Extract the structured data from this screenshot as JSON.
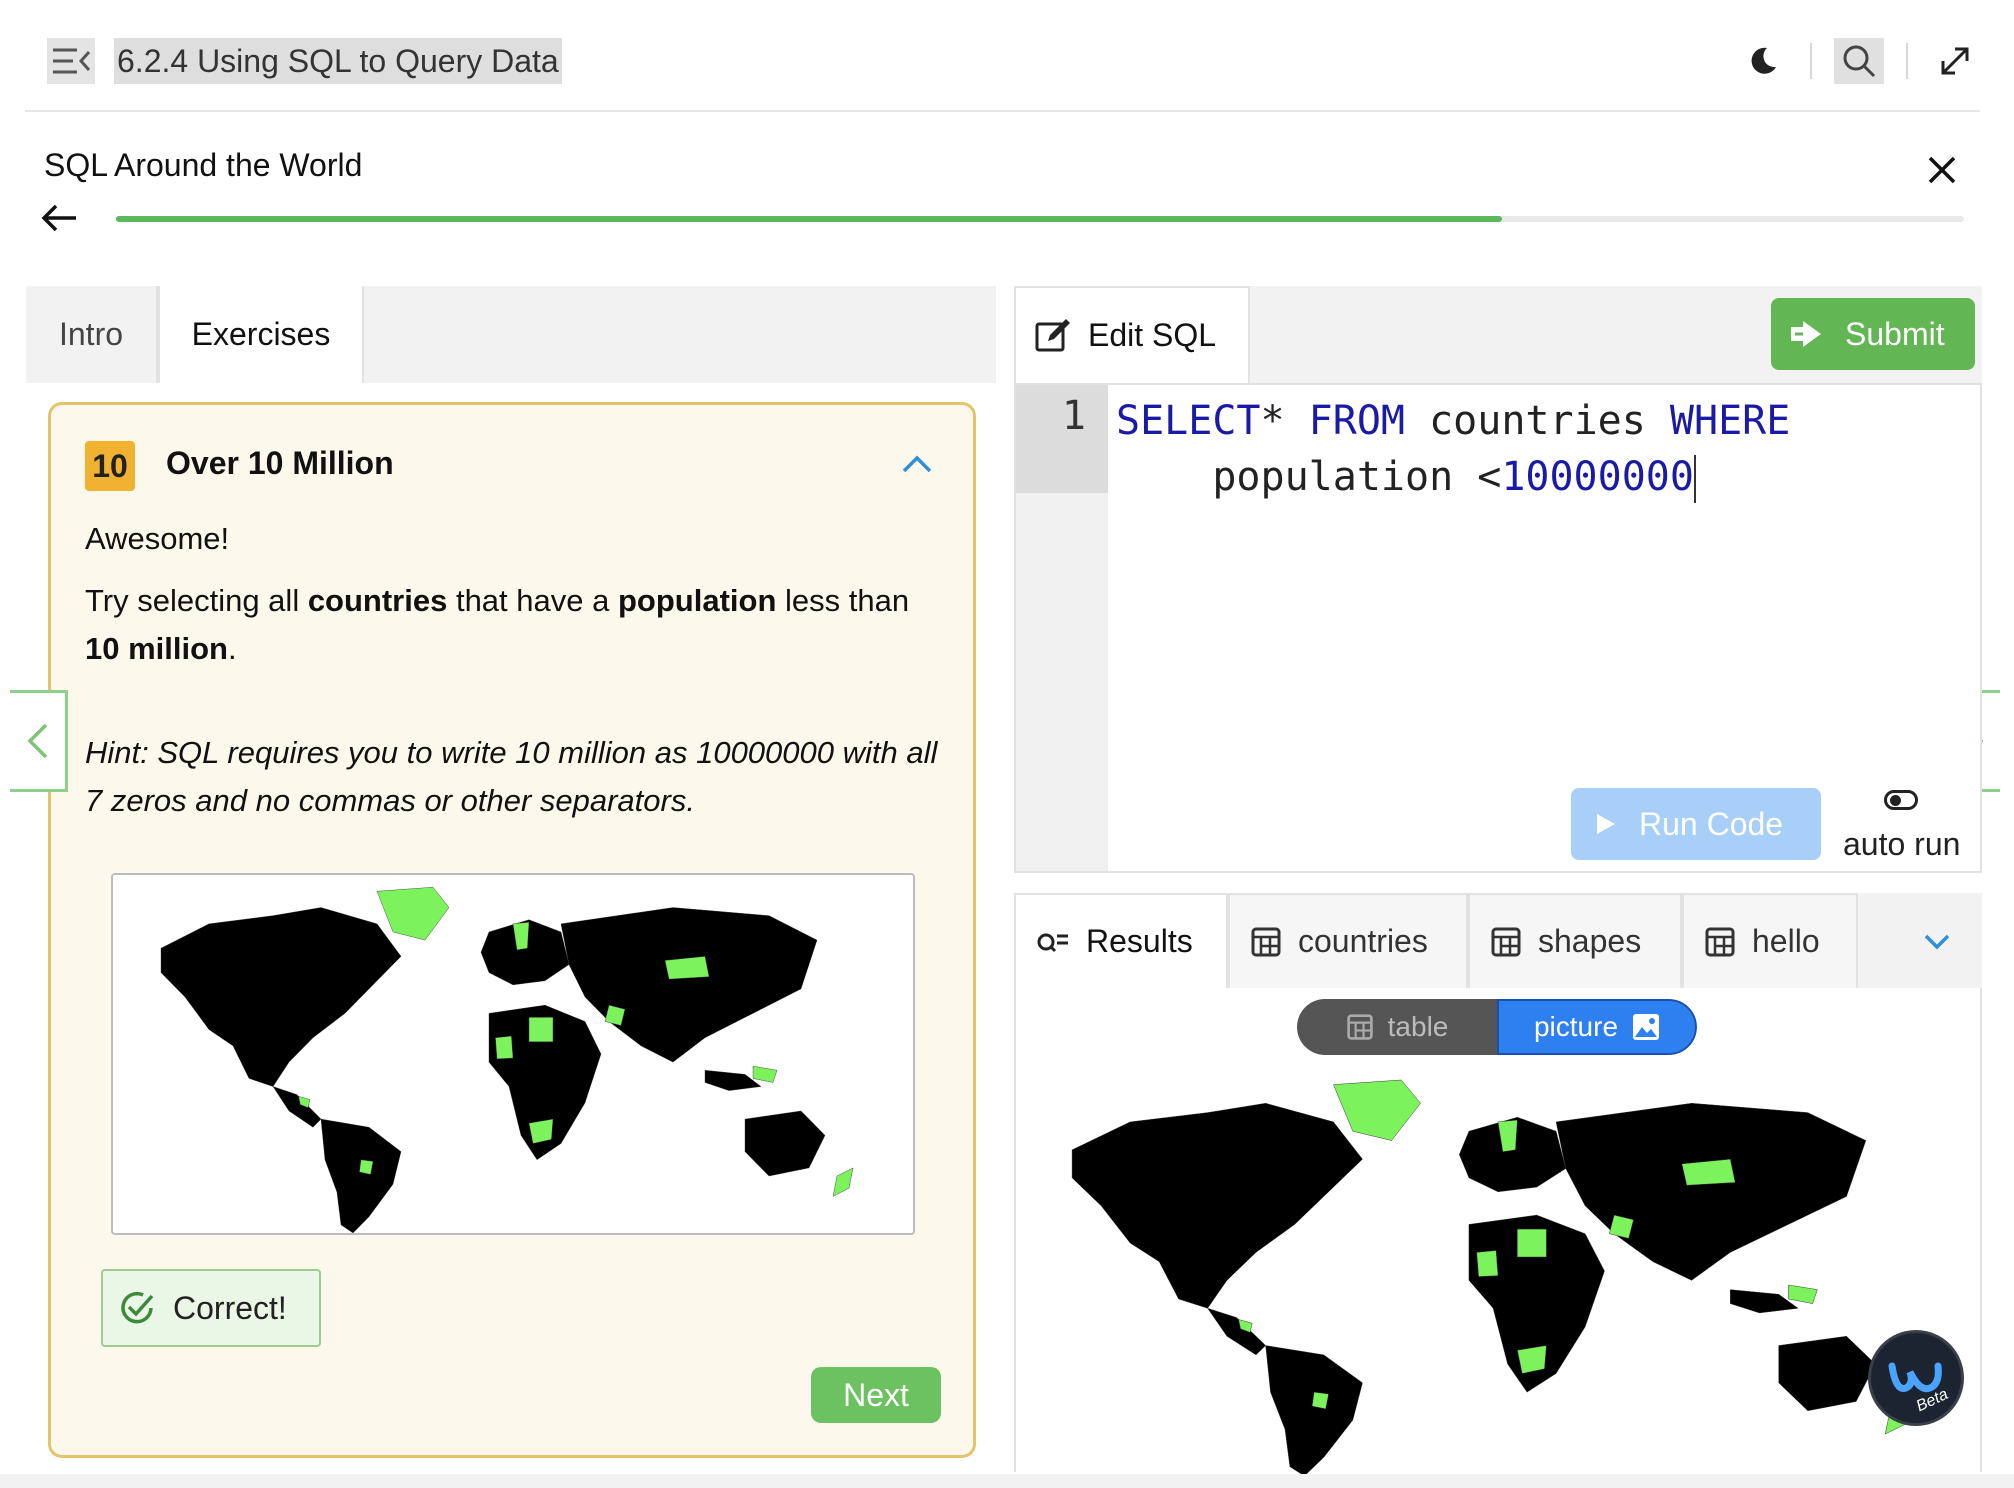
{
  "topbar": {
    "course_title": "6.2.4 Using SQL to Query Data",
    "icons": [
      "menu-collapse-icon",
      "moon-icon",
      "search-icon",
      "expand-icon"
    ]
  },
  "lesson": {
    "title": "SQL Around the World",
    "progress_fraction": 0.75
  },
  "left_tabs": [
    {
      "label": "Intro",
      "active": false
    },
    {
      "label": "Exercises",
      "active": true
    }
  ],
  "exercise": {
    "number": "10",
    "title": "Over 10 Million",
    "feedback": "Awesome!",
    "prompt_parts": [
      "Try selecting all ",
      "countries",
      " that have a ",
      "population",
      " less than ",
      "10 million",
      "."
    ],
    "hint": "Hint: SQL requires you to write 10 million as 10000000 with all 7 zeros and no commas or other separators.",
    "correct_label": "Correct!",
    "next_label": "Next"
  },
  "editor": {
    "tab_label": "Edit SQL",
    "submit_label": "Submit",
    "line_number": "1",
    "code_tokens": [
      {
        "t": "SELECT",
        "k": "kw"
      },
      {
        "t": "* ",
        "k": ""
      },
      {
        "t": "FROM",
        "k": "kw"
      },
      {
        "t": " countries ",
        "k": ""
      },
      {
        "t": "WHERE",
        "k": "kw"
      }
    ],
    "code_line2": [
      "    population <",
      "10000000"
    ],
    "run_label": "Run Code",
    "autorun_label": "auto run"
  },
  "results": {
    "tabs": [
      {
        "label": "Results",
        "icon": "results-icon",
        "active": true
      },
      {
        "label": "countries",
        "icon": "table-icon",
        "active": false
      },
      {
        "label": "shapes",
        "icon": "table-icon",
        "active": false
      },
      {
        "label": "hello",
        "icon": "table-icon",
        "active": false
      }
    ],
    "view_table_label": "table",
    "view_picture_label": "picture",
    "active_view": "picture",
    "beta_label": "Beta"
  },
  "colors": {
    "accent_green": "#5cb85c",
    "highlight_country": "#7cf25c",
    "other_country": "#000000",
    "card_bg": "#fdf8ec",
    "card_border": "#e4c36d",
    "badge": "#f2b231",
    "run_button": "#a8cff7",
    "picture_toggle": "#2e7ff0"
  }
}
